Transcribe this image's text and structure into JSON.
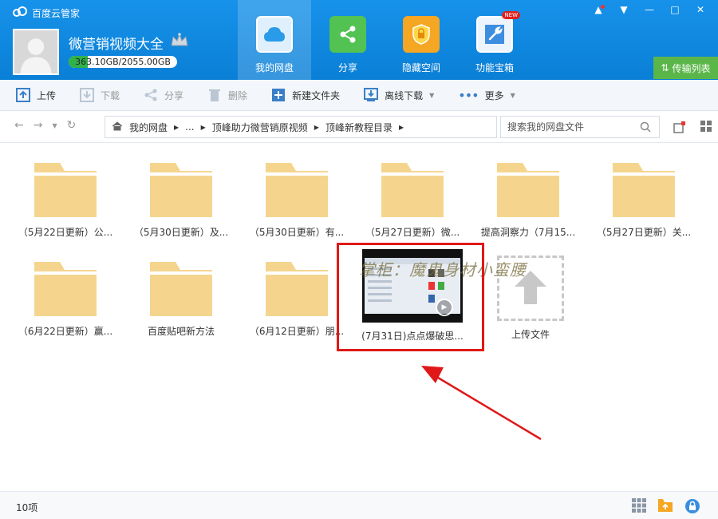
{
  "app": {
    "title": "百度云管家"
  },
  "window_controls": [
    "notify",
    "menu",
    "minimize",
    "maximize",
    "close"
  ],
  "user": {
    "name": "微营销视频大全",
    "quota_text": "363.10GB/2055.00GB",
    "quota_fraction": 0.177
  },
  "nav_tabs": [
    {
      "label": "我的网盘",
      "icon": "cloud-icon",
      "active": true
    },
    {
      "label": "分享",
      "icon": "share-icon",
      "active": false
    },
    {
      "label": "隐藏空间",
      "icon": "lock-icon",
      "active": false
    },
    {
      "label": "功能宝箱",
      "icon": "wrench-icon",
      "active": false,
      "badge": "NEW"
    }
  ],
  "transfer_label": "传输列表",
  "toolbar": {
    "upload": "上传",
    "download": "下载",
    "share": "分享",
    "delete": "删除",
    "new_folder": "新建文件夹",
    "offline": "离线下载",
    "more": "更多"
  },
  "breadcrumb": [
    "我的网盘",
    "...",
    "顶峰助力微营销原视频",
    "顶峰新教程目录"
  ],
  "search": {
    "placeholder": "搜索我的网盘文件"
  },
  "items": [
    {
      "name": "（5月22日更新）公...",
      "type": "folder"
    },
    {
      "name": "（5月30日更新）及...",
      "type": "folder"
    },
    {
      "name": "（5月30日更新）有...",
      "type": "folder"
    },
    {
      "name": "（5月27日更新）微...",
      "type": "folder"
    },
    {
      "name": "提高洞察力（7月15...",
      "type": "folder"
    },
    {
      "name": "（5月27日更新）关...",
      "type": "folder"
    },
    {
      "name": "（6月22日更新）赢...",
      "type": "folder"
    },
    {
      "name": "百度贴吧新方法",
      "type": "folder"
    },
    {
      "name": "（6月12日更新）朋...",
      "type": "folder"
    },
    {
      "name": "(7月31日)点点爆破思...",
      "type": "video"
    },
    {
      "name": "上传文件",
      "type": "upload"
    }
  ],
  "watermark": "掌柜：魔鬼身材小蛮腰",
  "status": {
    "count": "10项"
  },
  "colors": {
    "header": "#0d87e0",
    "folder": "#f5d58e",
    "highlight": "#e01818",
    "transfer": "#5bb64a"
  }
}
